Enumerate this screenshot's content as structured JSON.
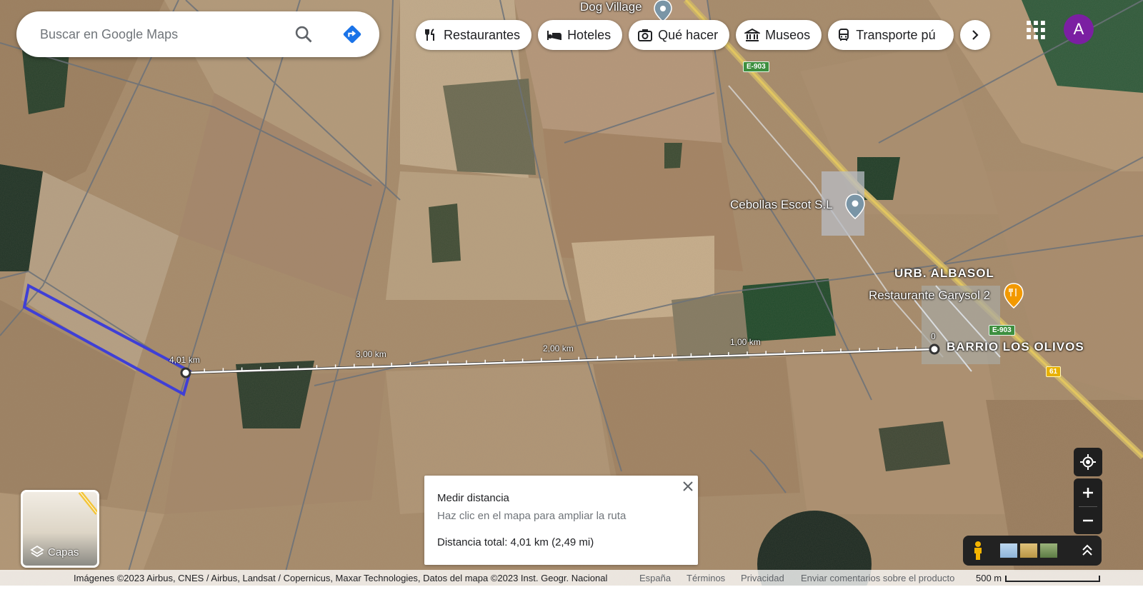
{
  "search": {
    "placeholder": "Buscar en Google Maps",
    "search_icon": "search-icon",
    "directions_icon": "directions-icon"
  },
  "chips": [
    {
      "label": "Restaurantes",
      "icon": "fork-knife-icon"
    },
    {
      "label": "Hoteles",
      "icon": "bed-icon"
    },
    {
      "label": "Qué hacer",
      "icon": "camera-icon"
    },
    {
      "label": "Museos",
      "icon": "museum-icon"
    },
    {
      "label": "Transporte pú",
      "icon": "bus-icon"
    }
  ],
  "account": {
    "avatar_letter": "A",
    "avatar_color": "#7b1fa2"
  },
  "map_labels": {
    "dog_village": "Dog Village",
    "cebollas": "Cebollas Escot S.L",
    "urb": "URB. ALBASOL",
    "restaurante": "Restaurante Garysol 2",
    "barrio": "BARRIO LOS OLIVOS"
  },
  "road_shields": {
    "e903_top": "E-903",
    "e903_right": "E-903",
    "n61": "61"
  },
  "measure_ticks": {
    "start": "0",
    "t1": "1,00 km",
    "t2": "2,00 km",
    "t3": "3,00 km",
    "end": "4,01 km"
  },
  "measure_panel": {
    "title": "Medir distancia",
    "hint": "Haz clic en el mapa para ampliar la ruta",
    "total": "Distancia total: 4,01 km (2,49 mi)"
  },
  "layers": {
    "label": "Capas"
  },
  "footer": {
    "attribution": "Imágenes ©2023 Airbus, CNES / Airbus, Landsat / Copernicus, Maxar Technologies, Datos del mapa ©2023 Inst. Geogr. Nacional",
    "country": "España",
    "terms": "Términos",
    "privacy": "Privacidad",
    "feedback": "Enviar comentarios sobre el producto",
    "scale": "500 m"
  },
  "colors": {
    "measure_line": "#ffffff",
    "polygon": "#3f3fd6",
    "shield_green": "#3d8f3f",
    "shield_yellow": "#e8b100"
  }
}
